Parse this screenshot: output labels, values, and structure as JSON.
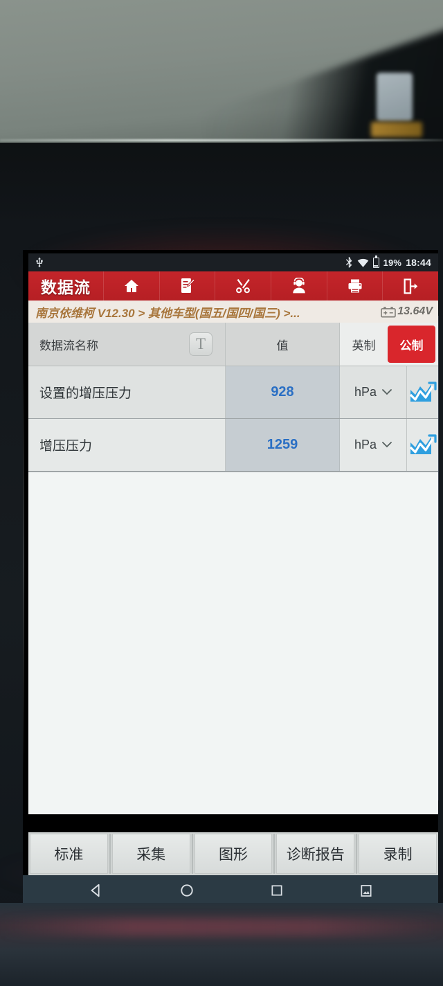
{
  "statusbar": {
    "usb_icon": "usb-icon",
    "bluetooth_icon": "bluetooth-icon",
    "wifi_icon": "wifi-icon",
    "battery_icon": "battery-icon",
    "battery_percent": "19%",
    "time": "18:44"
  },
  "appbar": {
    "title": "数据流",
    "accent_color": "#c4252a",
    "buttons": [
      {
        "name": "home-icon",
        "label": "主页"
      },
      {
        "name": "edit-report-icon",
        "label": "编辑"
      },
      {
        "name": "tools-icon",
        "label": "工具"
      },
      {
        "name": "support-agent-icon",
        "label": "远程协助"
      },
      {
        "name": "printer-icon",
        "label": "打印"
      },
      {
        "name": "exit-icon",
        "label": "退出"
      }
    ]
  },
  "breadcrumb": {
    "path": "南京依维柯 V12.30 > 其他车型(国五/国四/国三) >...",
    "battery_icon": "car-battery-icon",
    "voltage": "13.64V",
    "text_color": "#a8763c"
  },
  "table": {
    "headers": {
      "name": "数据流名称",
      "text_button": "T",
      "value": "值",
      "imperial": "英制",
      "metric": "公制"
    },
    "selected_unit_system": "公制",
    "rows": [
      {
        "name": "设置的增压压力",
        "value": "928",
        "unit": "hPa",
        "chart_icon": "line-chart-icon"
      },
      {
        "name": "增压压力",
        "value": "1259",
        "unit": "hPa",
        "chart_icon": "line-chart-icon"
      }
    ]
  },
  "bottombar": {
    "buttons": [
      "标准",
      "采集",
      "图形",
      "诊断报告",
      "录制"
    ]
  },
  "navbar": {
    "back": "back-icon",
    "home": "home-circle-icon",
    "recents": "recents-icon",
    "screenshot": "screenshot-icon"
  }
}
